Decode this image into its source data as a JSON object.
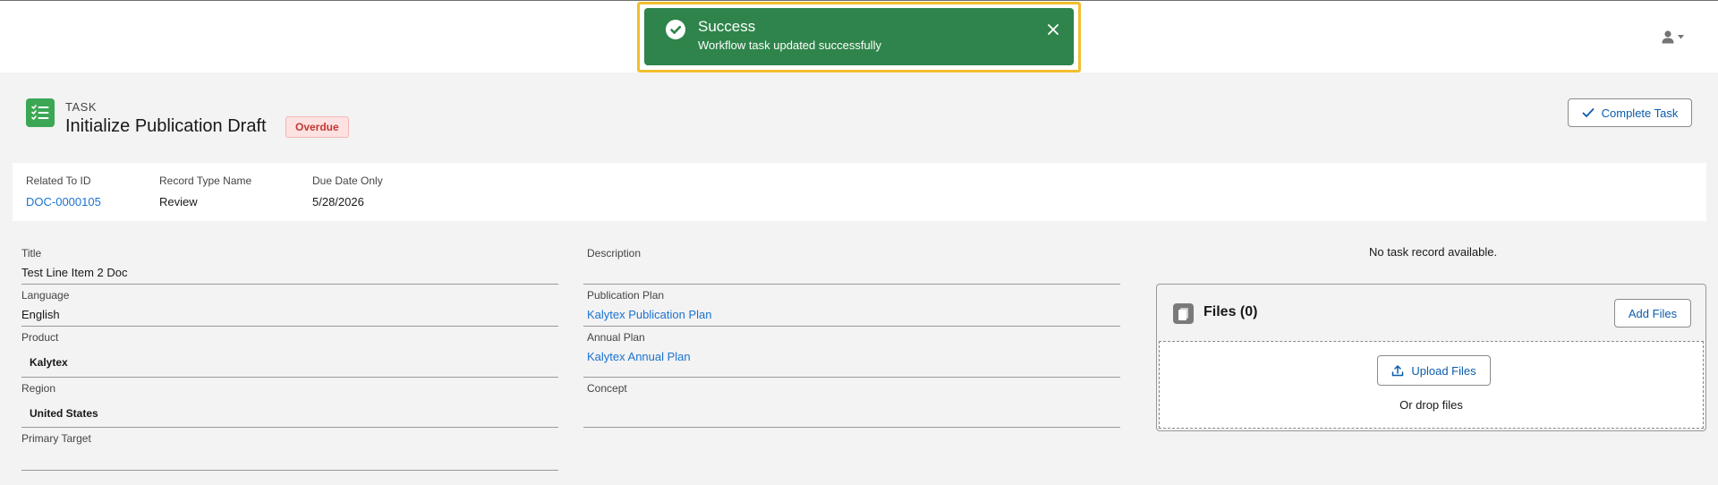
{
  "toast": {
    "title": "Success",
    "message": "Workflow task updated successfully",
    "color": "#2e844a",
    "icon": "check-circle-icon",
    "close_icon": "close-icon"
  },
  "header": {
    "object_label": "TASK",
    "title": "Initialize Publication Draft",
    "status_badge": "Overdue",
    "complete_button": "Complete Task"
  },
  "highlights": [
    {
      "label": "Related To ID",
      "value": "DOC-0000105"
    },
    {
      "label": "Record Type Name",
      "value": "Review"
    },
    {
      "label": "Due Date Only",
      "value": "5/28/2026"
    }
  ],
  "left_fields": [
    {
      "label": "Title",
      "value": "Test Line Item 2 Doc"
    },
    {
      "label": "Language",
      "value": "English"
    },
    {
      "label": "Product",
      "value": "Kalytex"
    },
    {
      "label": "Region",
      "value": "United States"
    },
    {
      "label": "Primary Target",
      "value": ""
    }
  ],
  "right_fields": [
    {
      "label": "Description",
      "value": ""
    },
    {
      "label": "Publication Plan",
      "value": "Kalytex Publication Plan"
    },
    {
      "label": "Annual Plan",
      "value": "Kalytex Annual Plan"
    },
    {
      "label": "Concept",
      "value": ""
    }
  ],
  "side_panel": {
    "no_record_text": "No task record available.",
    "files_title": "Files (0)",
    "add_files_button": "Add Files",
    "upload_button": "Upload Files",
    "drop_text": "Or drop files"
  },
  "colors": {
    "accent": "#0b5cab",
    "link": "#1b73d0",
    "task_icon": "#3ba755",
    "overdue": "#c23934"
  }
}
